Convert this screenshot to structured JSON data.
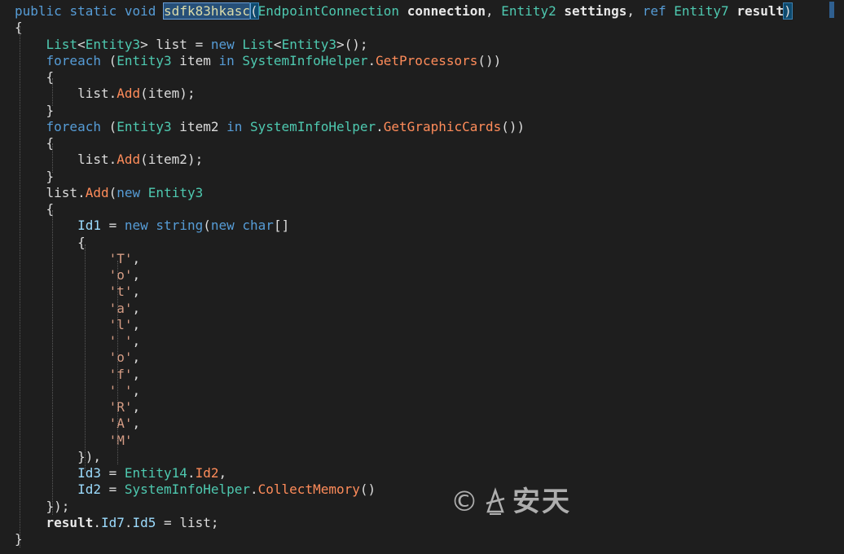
{
  "editor": {
    "lines": [
      [
        {
          "t": "public",
          "c": "kw"
        },
        {
          "t": " ",
          "c": "pu"
        },
        {
          "t": "static",
          "c": "kw"
        },
        {
          "t": " ",
          "c": "pu"
        },
        {
          "t": "void",
          "c": "kw"
        },
        {
          "t": " ",
          "c": "pu"
        },
        {
          "t": "sdfk83hkasc",
          "c": "hl-name"
        },
        {
          "t": "(",
          "c": "hl-paren"
        },
        {
          "t": "EndpointConnection",
          "c": "ty"
        },
        {
          "t": " ",
          "c": "pu"
        },
        {
          "t": "connection",
          "c": "bold"
        },
        {
          "t": ", ",
          "c": "pu"
        },
        {
          "t": "Entity2",
          "c": "ty"
        },
        {
          "t": " ",
          "c": "pu"
        },
        {
          "t": "settings",
          "c": "bold"
        },
        {
          "t": ", ",
          "c": "pu"
        },
        {
          "t": "ref",
          "c": "kw"
        },
        {
          "t": " ",
          "c": "pu"
        },
        {
          "t": "Entity7",
          "c": "ty"
        },
        {
          "t": " ",
          "c": "pu"
        },
        {
          "t": "result",
          "c": "bold"
        },
        {
          "t": ")",
          "c": "hl-paren"
        }
      ],
      [
        {
          "t": "{",
          "c": "pu"
        }
      ],
      [
        {
          "t": "    ",
          "c": "pu"
        },
        {
          "t": "List",
          "c": "ty"
        },
        {
          "t": "<",
          "c": "pu"
        },
        {
          "t": "Entity3",
          "c": "ty"
        },
        {
          "t": "> list = ",
          "c": "pu"
        },
        {
          "t": "new",
          "c": "kw"
        },
        {
          "t": " ",
          "c": "pu"
        },
        {
          "t": "List",
          "c": "ty"
        },
        {
          "t": "<",
          "c": "pu"
        },
        {
          "t": "Entity3",
          "c": "ty"
        },
        {
          "t": ">();",
          "c": "pu"
        }
      ],
      [
        {
          "t": "    ",
          "c": "pu"
        },
        {
          "t": "foreach",
          "c": "kw"
        },
        {
          "t": " (",
          "c": "pu"
        },
        {
          "t": "Entity3",
          "c": "ty"
        },
        {
          "t": " item ",
          "c": "pu"
        },
        {
          "t": "in",
          "c": "kw"
        },
        {
          "t": " ",
          "c": "pu"
        },
        {
          "t": "SystemInfoHelper",
          "c": "ty"
        },
        {
          "t": ".",
          "c": "pu"
        },
        {
          "t": "GetProcessors",
          "c": "mm"
        },
        {
          "t": "())",
          "c": "pu"
        }
      ],
      [
        {
          "t": "    {",
          "c": "pu"
        }
      ],
      [
        {
          "t": "        list.",
          "c": "pu"
        },
        {
          "t": "Add",
          "c": "mm"
        },
        {
          "t": "(item);",
          "c": "pu"
        }
      ],
      [
        {
          "t": "    }",
          "c": "pu"
        }
      ],
      [
        {
          "t": "    ",
          "c": "pu"
        },
        {
          "t": "foreach",
          "c": "kw"
        },
        {
          "t": " (",
          "c": "pu"
        },
        {
          "t": "Entity3",
          "c": "ty"
        },
        {
          "t": " item2 ",
          "c": "pu"
        },
        {
          "t": "in",
          "c": "kw"
        },
        {
          "t": " ",
          "c": "pu"
        },
        {
          "t": "SystemInfoHelper",
          "c": "ty"
        },
        {
          "t": ".",
          "c": "pu"
        },
        {
          "t": "GetGraphicCards",
          "c": "mm"
        },
        {
          "t": "())",
          "c": "pu"
        }
      ],
      [
        {
          "t": "    {",
          "c": "pu"
        }
      ],
      [
        {
          "t": "        list.",
          "c": "pu"
        },
        {
          "t": "Add",
          "c": "mm"
        },
        {
          "t": "(item2);",
          "c": "pu"
        }
      ],
      [
        {
          "t": "    }",
          "c": "pu"
        }
      ],
      [
        {
          "t": "    list.",
          "c": "pu"
        },
        {
          "t": "Add",
          "c": "mm"
        },
        {
          "t": "(",
          "c": "pu"
        },
        {
          "t": "new",
          "c": "kw"
        },
        {
          "t": " ",
          "c": "pu"
        },
        {
          "t": "Entity3",
          "c": "ty"
        }
      ],
      [
        {
          "t": "    {",
          "c": "pu"
        }
      ],
      [
        {
          "t": "        ",
          "c": "pu"
        },
        {
          "t": "Id1",
          "c": "pr"
        },
        {
          "t": " = ",
          "c": "pu"
        },
        {
          "t": "new",
          "c": "kw"
        },
        {
          "t": " ",
          "c": "pu"
        },
        {
          "t": "string",
          "c": "kw"
        },
        {
          "t": "(",
          "c": "pu"
        },
        {
          "t": "new",
          "c": "kw"
        },
        {
          "t": " ",
          "c": "pu"
        },
        {
          "t": "char",
          "c": "kw"
        },
        {
          "t": "[]",
          "c": "pu"
        }
      ],
      [
        {
          "t": "        {",
          "c": "pu"
        }
      ],
      [
        {
          "t": "            ",
          "c": "pu"
        },
        {
          "t": "'T'",
          "c": "str"
        },
        {
          "t": ",",
          "c": "pu"
        }
      ],
      [
        {
          "t": "            ",
          "c": "pu"
        },
        {
          "t": "'o'",
          "c": "str"
        },
        {
          "t": ",",
          "c": "pu"
        }
      ],
      [
        {
          "t": "            ",
          "c": "pu"
        },
        {
          "t": "'t'",
          "c": "str"
        },
        {
          "t": ",",
          "c": "pu"
        }
      ],
      [
        {
          "t": "            ",
          "c": "pu"
        },
        {
          "t": "'a'",
          "c": "str"
        },
        {
          "t": ",",
          "c": "pu"
        }
      ],
      [
        {
          "t": "            ",
          "c": "pu"
        },
        {
          "t": "'l'",
          "c": "str"
        },
        {
          "t": ",",
          "c": "pu"
        }
      ],
      [
        {
          "t": "            ",
          "c": "pu"
        },
        {
          "t": "' '",
          "c": "str"
        },
        {
          "t": ",",
          "c": "pu"
        }
      ],
      [
        {
          "t": "            ",
          "c": "pu"
        },
        {
          "t": "'o'",
          "c": "str"
        },
        {
          "t": ",",
          "c": "pu"
        }
      ],
      [
        {
          "t": "            ",
          "c": "pu"
        },
        {
          "t": "'f'",
          "c": "str"
        },
        {
          "t": ",",
          "c": "pu"
        }
      ],
      [
        {
          "t": "            ",
          "c": "pu"
        },
        {
          "t": "' '",
          "c": "str"
        },
        {
          "t": ",",
          "c": "pu"
        }
      ],
      [
        {
          "t": "            ",
          "c": "pu"
        },
        {
          "t": "'R'",
          "c": "str"
        },
        {
          "t": ",",
          "c": "pu"
        }
      ],
      [
        {
          "t": "            ",
          "c": "pu"
        },
        {
          "t": "'A'",
          "c": "str"
        },
        {
          "t": ",",
          "c": "pu"
        }
      ],
      [
        {
          "t": "            ",
          "c": "pu"
        },
        {
          "t": "'M'",
          "c": "str"
        }
      ],
      [
        {
          "t": "        }),",
          "c": "pu"
        }
      ],
      [
        {
          "t": "        ",
          "c": "pu"
        },
        {
          "t": "Id3",
          "c": "pr"
        },
        {
          "t": " = ",
          "c": "pu"
        },
        {
          "t": "Entity14",
          "c": "ty"
        },
        {
          "t": ".",
          "c": "pu"
        },
        {
          "t": "Id2",
          "c": "mm"
        },
        {
          "t": ",",
          "c": "pu"
        }
      ],
      [
        {
          "t": "        ",
          "c": "pu"
        },
        {
          "t": "Id2",
          "c": "pr"
        },
        {
          "t": " = ",
          "c": "pu"
        },
        {
          "t": "SystemInfoHelper",
          "c": "ty"
        },
        {
          "t": ".",
          "c": "pu"
        },
        {
          "t": "CollectMemory",
          "c": "mm"
        },
        {
          "t": "()",
          "c": "pu"
        }
      ],
      [
        {
          "t": "    });",
          "c": "pu"
        }
      ],
      [
        {
          "t": "    ",
          "c": "pu"
        },
        {
          "t": "result",
          "c": "bold"
        },
        {
          "t": ".",
          "c": "pu"
        },
        {
          "t": "Id7",
          "c": "pr"
        },
        {
          "t": ".",
          "c": "pu"
        },
        {
          "t": "Id5",
          "c": "pr"
        },
        {
          "t": " = list;",
          "c": "pu"
        }
      ],
      [
        {
          "t": "}",
          "c": "pu"
        }
      ]
    ]
  },
  "watermark": {
    "copyright_symbol": "©",
    "text": "安天"
  },
  "colors": {
    "background": "#1e1e1e",
    "keyword": "#569cd6",
    "type": "#4ec9b0",
    "method": "#ff8c5a",
    "string": "#d69d85",
    "property": "#9cdcfe",
    "selection": "#264f78"
  }
}
